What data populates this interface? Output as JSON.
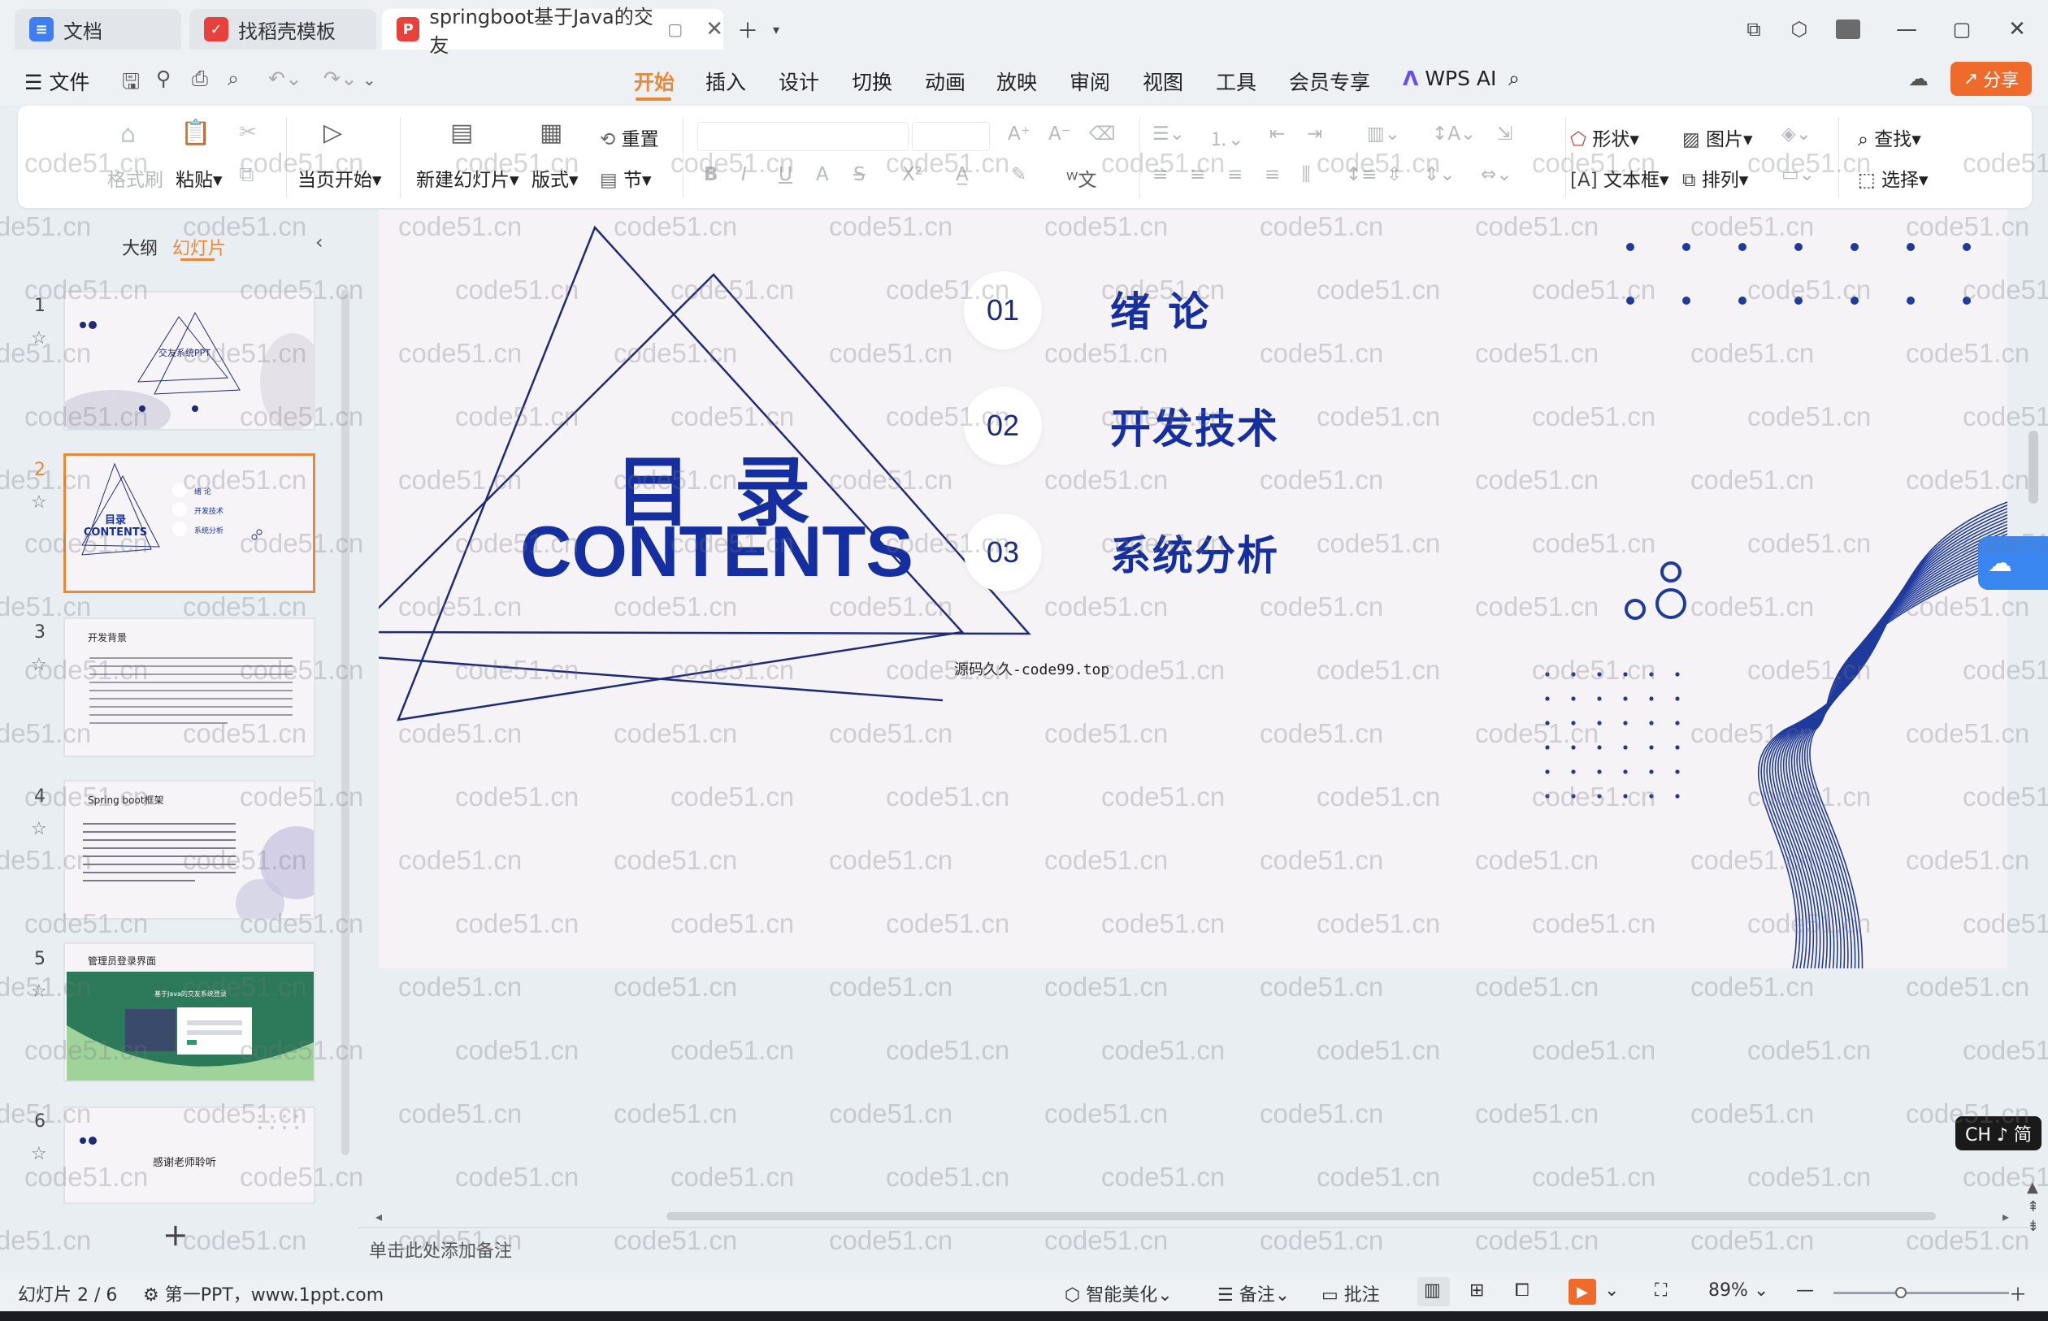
{
  "tabs": [
    {
      "label": "文档"
    },
    {
      "label": "找稻壳模板"
    },
    {
      "label": "springboot基于Java的交友"
    }
  ],
  "menu": {
    "file": "文件",
    "items": [
      "开始",
      "插入",
      "设计",
      "切换",
      "动画",
      "放映",
      "审阅",
      "视图",
      "工具",
      "会员专享"
    ],
    "wps_ai": "WPS AI",
    "share": "分享"
  },
  "ribbon": {
    "format_painter": "格式刷",
    "paste": "粘贴",
    "start_from_current": "当页开始",
    "new_slide": "新建幻灯片",
    "layout": "版式",
    "reset": "重置",
    "section": "节",
    "shape": "形状",
    "picture": "图片",
    "find": "查找",
    "textbox": "文本框",
    "arrange": "排列",
    "select": "选择"
  },
  "panel": {
    "outline_tab": "大纲",
    "slides_tab": "幻灯片",
    "add": "+"
  },
  "thumbnails": [
    {
      "num": "1",
      "title": "交友系统PPT"
    },
    {
      "num": "2",
      "title": "目录 CONTENTS"
    },
    {
      "num": "3",
      "title": "开发背景"
    },
    {
      "num": "4",
      "title": "Spring boot框架"
    },
    {
      "num": "5",
      "title": "管理员登录界面"
    },
    {
      "num": "6",
      "title": "感谢老师聆听"
    }
  ],
  "slide": {
    "title_cn": "目 录",
    "title_en": "CONTENTS",
    "items": [
      {
        "num": "01",
        "label": "绪  论"
      },
      {
        "num": "02",
        "label": "开发技术"
      },
      {
        "num": "03",
        "label": "系统分析"
      }
    ],
    "source": "源码久久-code99.top"
  },
  "notes_placeholder": "单击此处添加备注",
  "status": {
    "slide_counter": "幻灯片 2 / 6",
    "theme": "第一PPT，www.1ppt.com",
    "beautify": "智能美化",
    "notes": "备注",
    "comments": "批注",
    "zoom": "89%"
  },
  "ime": "CH ♪ 简",
  "watermark": "code51.cn",
  "colors": {
    "accent": "#e8893a",
    "navy": "#152fa0",
    "line": "#1e2a7a"
  }
}
